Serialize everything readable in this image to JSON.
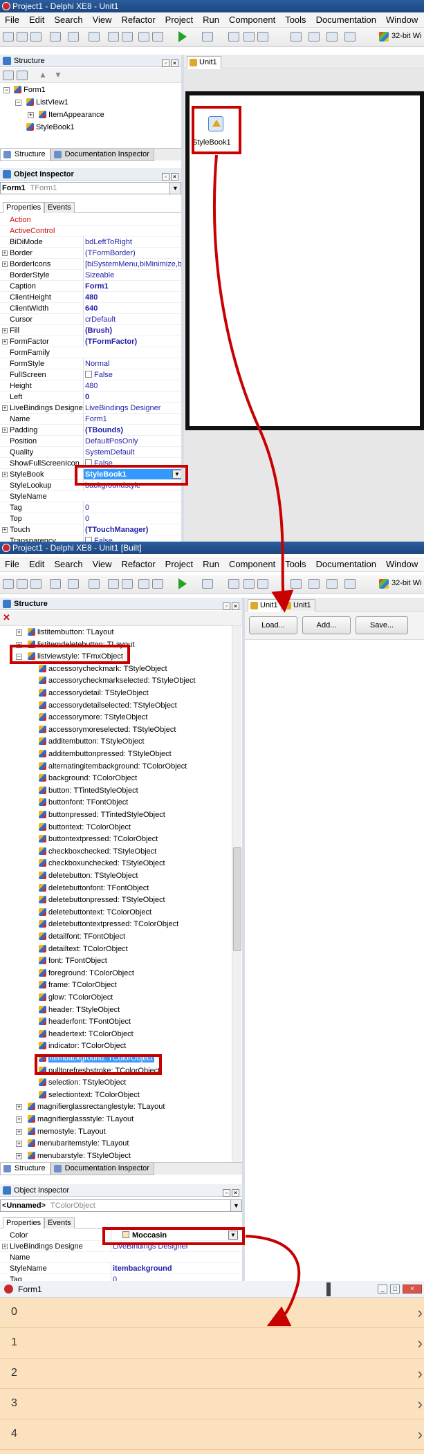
{
  "window1": {
    "title": "Project1 - Delphi XE8 - Unit1",
    "menu": [
      "File",
      "Edit",
      "Search",
      "View",
      "Refactor",
      "Project",
      "Run",
      "Component",
      "Tools",
      "Documentation",
      "Window"
    ],
    "platform": "32-bit Wi",
    "structure": {
      "title": "Structure",
      "tree": [
        "Form1",
        "ListView1",
        "ItemAppearance",
        "StyleBook1"
      ],
      "tabs": [
        "Structure",
        "Documentation Inspector"
      ]
    },
    "inspector": {
      "title": "Object Inspector",
      "object": "Form1",
      "object_type": "TForm1",
      "tabs": [
        "Properties",
        "Events"
      ],
      "rows": [
        {
          "name": "Action",
          "value": "",
          "red": true
        },
        {
          "name": "ActiveControl",
          "value": "",
          "red": true
        },
        {
          "name": "BiDiMode",
          "value": "bdLeftToRight"
        },
        {
          "name": "Border",
          "value": "(TFormBorder)",
          "plus": true
        },
        {
          "name": "BorderIcons",
          "value": "[biSystemMenu,biMinimize,biM",
          "plus": true
        },
        {
          "name": "BorderStyle",
          "value": "Sizeable"
        },
        {
          "name": "Caption",
          "value": "Form1",
          "bold": true
        },
        {
          "name": "ClientHeight",
          "value": "480",
          "bold": true
        },
        {
          "name": "ClientWidth",
          "value": "640",
          "bold": true
        },
        {
          "name": "Cursor",
          "value": "crDefault"
        },
        {
          "name": "Fill",
          "value": "(Brush)",
          "bold": true,
          "plus": true
        },
        {
          "name": "FormFactor",
          "value": "(TFormFactor)",
          "bold": true,
          "plus": true
        },
        {
          "name": "FormFamily",
          "value": ""
        },
        {
          "name": "FormStyle",
          "value": "Normal"
        },
        {
          "name": "FullScreen",
          "value": "False",
          "check": true
        },
        {
          "name": "Height",
          "value": "480"
        },
        {
          "name": "Left",
          "value": "0",
          "bold": true
        },
        {
          "name": "LiveBindings Designer",
          "value": "LiveBindings Designer",
          "plus": true
        },
        {
          "name": "Name",
          "value": "Form1"
        },
        {
          "name": "Padding",
          "value": "(TBounds)",
          "bold": true,
          "plus": true
        },
        {
          "name": "Position",
          "value": "DefaultPosOnly"
        },
        {
          "name": "Quality",
          "value": "SystemDefault"
        },
        {
          "name": "ShowFullScreenIcon",
          "value": "False",
          "check": true
        },
        {
          "name": "StyleBook",
          "value": "StyleBook1",
          "plus": true,
          "selected": true
        },
        {
          "name": "StyleLookup",
          "value": "backgroundstyle"
        },
        {
          "name": "StyleName",
          "value": ""
        },
        {
          "name": "Tag",
          "value": "0"
        },
        {
          "name": "Top",
          "value": "0"
        },
        {
          "name": "Touch",
          "value": "(TTouchManager)",
          "bold": true,
          "plus": true
        },
        {
          "name": "Transparency",
          "value": "False",
          "check": true
        }
      ]
    },
    "designer": {
      "tab": "Unit1",
      "component_label": "StyleBook1"
    }
  },
  "window2": {
    "title": "Project1 - Delphi XE8 - Unit1 [Built]",
    "menu": [
      "File",
      "Edit",
      "Search",
      "View",
      "Refactor",
      "Project",
      "Run",
      "Component",
      "Tools",
      "Documentation",
      "Window"
    ],
    "platform": "32-bit Wi",
    "structure": {
      "title": "Structure",
      "tree": [
        {
          "label": "listitembutton: TLayout",
          "level": 1,
          "exp": true
        },
        {
          "label": "listitemdeletebutton: TLayout",
          "level": 1,
          "exp": true
        },
        {
          "label": "listviewstyle: TFmxObject",
          "level": 1,
          "exp": true,
          "open": true
        },
        {
          "label": "accessorycheckmark: TStyleObject",
          "level": 2
        },
        {
          "label": "accessorycheckmarkselected: TStyleObject",
          "level": 2
        },
        {
          "label": "accessorydetail: TStyleObject",
          "level": 2
        },
        {
          "label": "accessorydetailselected: TStyleObject",
          "level": 2
        },
        {
          "label": "accessorymore: TStyleObject",
          "level": 2
        },
        {
          "label": "accessorymoreselected: TStyleObject",
          "level": 2
        },
        {
          "label": "additembutton: TStyleObject",
          "level": 2
        },
        {
          "label": "additembuttonpressed: TStyleObject",
          "level": 2
        },
        {
          "label": "alternatingitembackground: TColorObject",
          "level": 2
        },
        {
          "label": "background: TColorObject",
          "level": 2
        },
        {
          "label": "button: TTintedStyleObject",
          "level": 2
        },
        {
          "label": "buttonfont: TFontObject",
          "level": 2
        },
        {
          "label": "buttonpressed: TTintedStyleObject",
          "level": 2
        },
        {
          "label": "buttontext: TColorObject",
          "level": 2
        },
        {
          "label": "buttontextpressed: TColorObject",
          "level": 2
        },
        {
          "label": "checkboxchecked: TStyleObject",
          "level": 2
        },
        {
          "label": "checkboxunchecked: TStyleObject",
          "level": 2
        },
        {
          "label": "deletebutton: TStyleObject",
          "level": 2
        },
        {
          "label": "deletebuttonfont: TFontObject",
          "level": 2
        },
        {
          "label": "deletebuttonpressed: TStyleObject",
          "level": 2
        },
        {
          "label": "deletebuttontext: TColorObject",
          "level": 2
        },
        {
          "label": "deletebuttontextpressed: TColorObject",
          "level": 2
        },
        {
          "label": "detailfont: TFontObject",
          "level": 2
        },
        {
          "label": "detailtext: TColorObject",
          "level": 2
        },
        {
          "label": "font: TFontObject",
          "level": 2
        },
        {
          "label": "foreground: TColorObject",
          "level": 2
        },
        {
          "label": "frame: TColorObject",
          "level": 2
        },
        {
          "label": "glow: TColorObject",
          "level": 2
        },
        {
          "label": "header: TStyleObject",
          "level": 2
        },
        {
          "label": "headerfont: TFontObject",
          "level": 2
        },
        {
          "label": "headertext: TColorObject",
          "level": 2
        },
        {
          "label": "indicator: TColorObject",
          "level": 2
        },
        {
          "label": "itembackground: TColorObject",
          "level": 2,
          "selected": true
        },
        {
          "label": "pulltorefreshstroke: TColorObject",
          "level": 2
        },
        {
          "label": "selection: TStyleObject",
          "level": 2
        },
        {
          "label": "selectiontext: TColorObject",
          "level": 2
        },
        {
          "label": "magnifierglassrectanglestyle: TLayout",
          "level": 1,
          "exp": true
        },
        {
          "label": "magnifierglassstyle: TLayout",
          "level": 1,
          "exp": true
        },
        {
          "label": "memostyle: TLayout",
          "level": 1,
          "exp": true
        },
        {
          "label": "menubaritemstyle: TLayout",
          "level": 1,
          "exp": true
        },
        {
          "label": "menubarstyle: TStyleObject",
          "level": 1,
          "exp": true
        }
      ],
      "tabs": [
        "Structure",
        "Documentation Inspector"
      ]
    },
    "designer": {
      "tabs": [
        "Unit1",
        "Unit1"
      ],
      "buttons": [
        "Load...",
        "Add...",
        "Save..."
      ]
    },
    "inspector": {
      "title": "Object Inspector",
      "object": "<Unnamed>",
      "object_type": "TColorObject",
      "tabs": [
        "Properties",
        "Events"
      ],
      "rows": [
        {
          "name": "Color",
          "value": "Moccasin",
          "selected": true
        },
        {
          "name": "LiveBindings Designer",
          "value": "LiveBindings Designer",
          "plus": true
        },
        {
          "name": "Name",
          "value": ""
        },
        {
          "name": "StyleName",
          "value": "itembackground",
          "bold": true
        },
        {
          "name": "Tag",
          "value": "0"
        }
      ]
    }
  },
  "form1": {
    "title": "Form1",
    "items": [
      "0",
      "1",
      "2",
      "3",
      "4"
    ],
    "item_color": "#fbe1bd"
  },
  "colors": {
    "annotation": "#c80000",
    "moccasin": "#ffe4b5",
    "selection": "#3399ff"
  }
}
